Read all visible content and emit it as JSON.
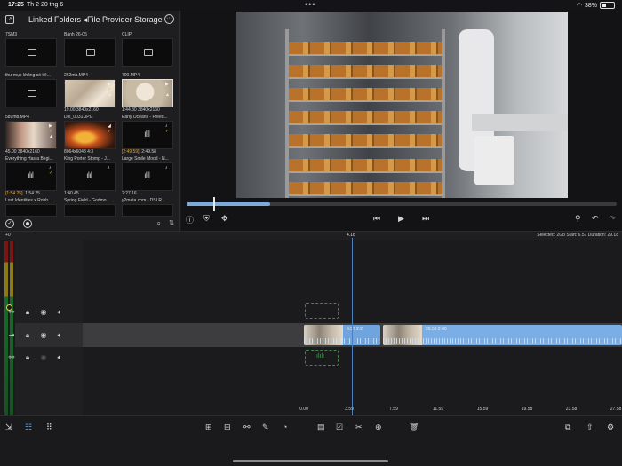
{
  "status": {
    "time": "17:25",
    "date": "Th 2 20 thg 6",
    "dots": "•••",
    "wifi_icon": "wifi-icon",
    "battery": "38%"
  },
  "browser": {
    "title": "Linked Folders ◂File Provider Storage",
    "tiles": [
      {
        "label": "7SM3",
        "kind": "folder",
        "sub": ""
      },
      {
        "label": "Bánh 26-05",
        "kind": "folder",
        "sub": ""
      },
      {
        "label": "CLIP",
        "kind": "folder",
        "sub": ""
      },
      {
        "label": "thư mục không có tiê...",
        "kind": "folder",
        "sub": ""
      },
      {
        "label": "262mb.MP4",
        "kind": "video",
        "sub": "19.00  3840x2160"
      },
      {
        "label": "700.MP4",
        "kind": "video",
        "sub": "1:44.30  3840x2160"
      },
      {
        "label": "589mb.MP4",
        "kind": "video",
        "sub": "45.00  3840x2160"
      },
      {
        "label": "DJI_0031.JPG",
        "kind": "image",
        "sub": "8064x6048  4:3"
      },
      {
        "label": "Early Oceans - Freed...",
        "kind": "audio",
        "sub_amber": "[2:49.59]",
        "sub": "2:49.58"
      },
      {
        "label": "Everything Has a Begi...",
        "kind": "audio",
        "sub_amber": "[1:54.25]",
        "sub": "1:54.25"
      },
      {
        "label": "King Porter Stomp - J...",
        "kind": "audio",
        "sub": "1:40.45"
      },
      {
        "label": "Large Smile Mood - N...",
        "kind": "audio",
        "sub": "2:27.16"
      },
      {
        "label": "Lost Identities x Robb...",
        "kind": "audio",
        "sub": ""
      },
      {
        "label": "Spring Field - Godmo...",
        "kind": "audio",
        "sub": ""
      },
      {
        "label": "y2meta.com - DSLR...",
        "kind": "audio",
        "sub": ""
      }
    ]
  },
  "viewer": {
    "scrub_progress": 0.195
  },
  "timeline": {
    "playhead_time": "4.18",
    "meter_label": "+0",
    "selection_info": "Selected: 2Gb  Start: 6.57  Duration: 29.18",
    "clip1_label": "6.57  2:2",
    "clip2_label": "29.58  2:00",
    "ruler": [
      "0.00",
      "3.59",
      "7.59",
      "11.59",
      "15.59",
      "19.58",
      "23.58",
      "27.58"
    ]
  }
}
